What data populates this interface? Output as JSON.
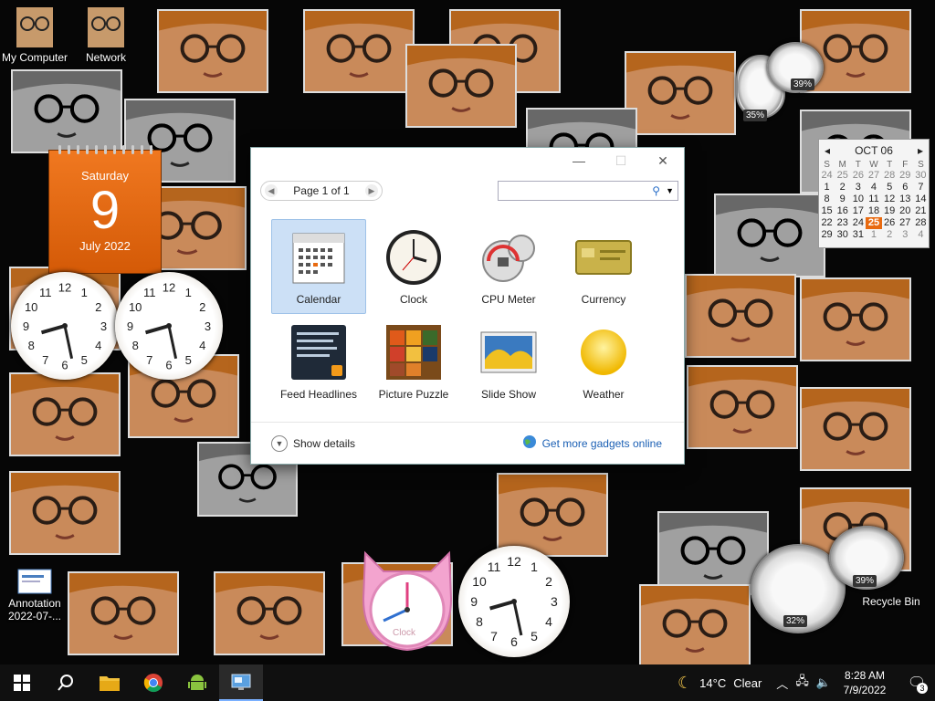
{
  "desktop": {
    "icons": [
      {
        "label": "My Computer"
      },
      {
        "label": "Network"
      },
      {
        "label": "Annotation 2022-07-..."
      },
      {
        "label": "Recycle Bin"
      }
    ],
    "calendar_gadget": {
      "day_name": "Saturday",
      "day_number": "9",
      "month_year": "July 2022"
    },
    "mini_calendar": {
      "month_label": "OCT 06",
      "weekday_headers": [
        "S",
        "M",
        "T",
        "W",
        "T",
        "F",
        "S"
      ],
      "weeks": [
        [
          "24",
          "25",
          "26",
          "27",
          "28",
          "29",
          "30"
        ],
        [
          "1",
          "2",
          "3",
          "4",
          "5",
          "6",
          "7"
        ],
        [
          "8",
          "9",
          "10",
          "11",
          "12",
          "13",
          "14"
        ],
        [
          "15",
          "16",
          "17",
          "18",
          "19",
          "20",
          "21"
        ],
        [
          "22",
          "23",
          "24",
          "25",
          "26",
          "27",
          "28"
        ],
        [
          "29",
          "30",
          "31",
          "1",
          "2",
          "3",
          "4"
        ]
      ],
      "today": "25"
    },
    "cpu_meters": [
      {
        "cpu": "35%",
        "ram": "39%"
      },
      {
        "cpu": "32%",
        "ram": "39%"
      }
    ],
    "cat_clock_label": "Clock"
  },
  "gallery": {
    "pager_text": "Page 1 of 1",
    "search_placeholder": "",
    "gadgets": [
      {
        "label": "Calendar",
        "icon": "calendar-icon"
      },
      {
        "label": "Clock",
        "icon": "clock-icon"
      },
      {
        "label": "CPU Meter",
        "icon": "cpu-meter-icon"
      },
      {
        "label": "Currency",
        "icon": "currency-icon"
      },
      {
        "label": "Feed Headlines",
        "icon": "feed-icon"
      },
      {
        "label": "Picture Puzzle",
        "icon": "puzzle-icon"
      },
      {
        "label": "Slide Show",
        "icon": "slideshow-icon"
      },
      {
        "label": "Weather",
        "icon": "weather-icon"
      }
    ],
    "show_details": "Show details",
    "get_more": "Get more gadgets online"
  },
  "taskbar": {
    "weather_temp": "14°C",
    "weather_cond": "Clear",
    "time": "8:28 AM",
    "date": "7/9/2022",
    "notifications": "3"
  }
}
